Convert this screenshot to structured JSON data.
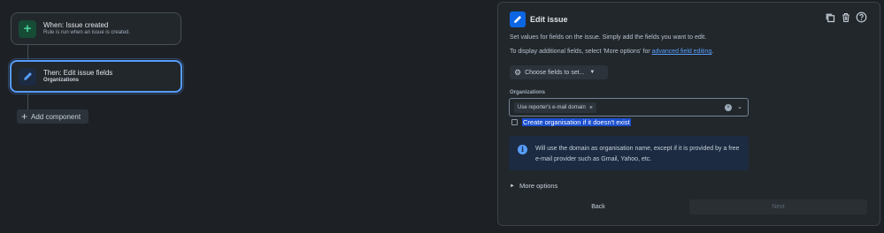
{
  "canvas": {
    "trigger_node": {
      "title": "When: Issue created",
      "subtitle": "Rule is run when an issue is created."
    },
    "action_node": {
      "title": "Then: Edit issue fields",
      "subtitle": "Organizations"
    },
    "add_component_label": "Add component"
  },
  "panel": {
    "title": "Edit issue",
    "description": "Set values for fields on the issue. Simply add the fields you want to edit.",
    "more_text_prefix": "To display additional fields, select 'More options' for ",
    "more_text_link": "advanced field editing",
    "more_text_suffix": ".",
    "choose_fields_label": "Choose fields to set...",
    "organizations": {
      "label": "Organizations",
      "chip": "Use reporter's e-mail domain"
    },
    "create_org_checkbox_label": "Create organisation if it doesn't exist",
    "create_org_checked": false,
    "info_text": "Will use the domain as organisation name, except if it is provided by a free e-mail provider such as Gmail, Yahoo, etc.",
    "more_options_label": "More options",
    "back_label": "Back",
    "next_label": "Next"
  },
  "colors": {
    "background": "#1d2125",
    "panel": "#22272b",
    "accent": "#579dff",
    "selection": "#1b4fcf"
  }
}
